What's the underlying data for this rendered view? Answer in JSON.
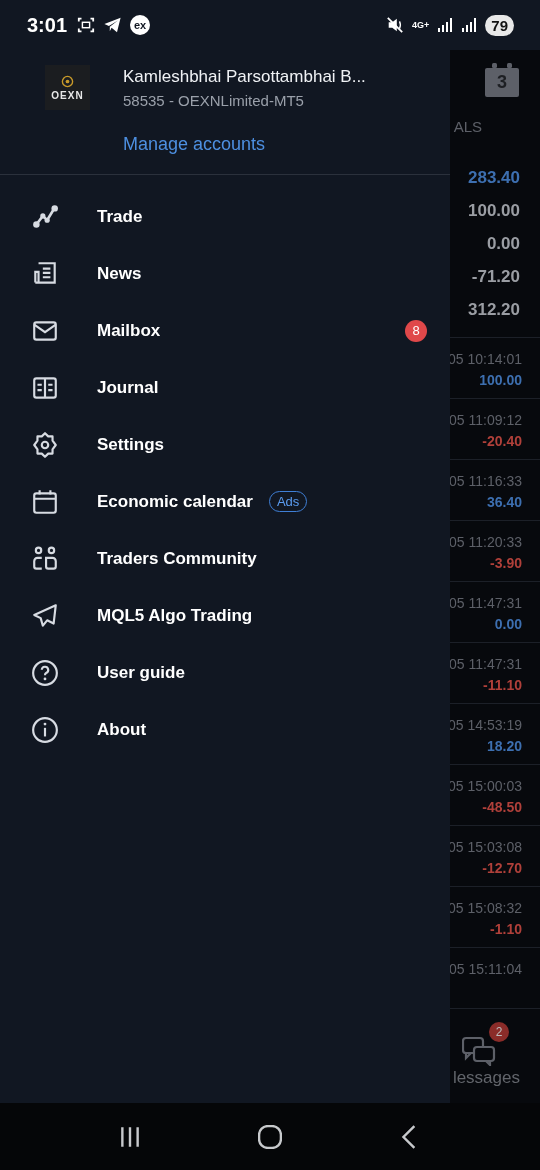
{
  "status_bar": {
    "time": "3:01",
    "app_badge": "ex",
    "network": "4G+",
    "battery": "79"
  },
  "drawer": {
    "account": {
      "logo": "OEXN",
      "name": "Kamleshbhai Parsottambhai B...",
      "server": "58535 - OEXNLimited-MT5"
    },
    "manage_link": "Manage accounts",
    "items": [
      {
        "label": "Trade"
      },
      {
        "label": "News"
      },
      {
        "label": "Mailbox",
        "badge": "8"
      },
      {
        "label": "Journal"
      },
      {
        "label": "Settings"
      },
      {
        "label": "Economic calendar",
        "tag": "Ads"
      },
      {
        "label": "Traders Community"
      },
      {
        "label": "MQL5 Algo Trading"
      },
      {
        "label": "User guide"
      },
      {
        "label": "About"
      }
    ]
  },
  "background": {
    "calendar_day": "3",
    "column_header": "ALS",
    "summary": [
      {
        "value": "283.40",
        "color": "#3d6fb0"
      },
      {
        "value": "100.00",
        "color": "#9a9da3"
      },
      {
        "value": "0.00",
        "color": "#9a9da3"
      },
      {
        "value": "-71.20",
        "color": "#9a9da3"
      },
      {
        "value": "312.20",
        "color": "#9a9da3"
      }
    ],
    "deals": [
      {
        "time": "05 10:14:01",
        "profit": "100.00",
        "color": "#3d6fb0"
      },
      {
        "time": "05 11:09:12",
        "profit": "-20.40",
        "color": "#b0403a"
      },
      {
        "time": "05 11:16:33",
        "profit": "36.40",
        "color": "#3d6fb0"
      },
      {
        "time": "05 11:20:33",
        "profit": "-3.90",
        "color": "#b0403a"
      },
      {
        "time": "05 11:47:31",
        "profit": "0.00",
        "color": "#3d6fb0"
      },
      {
        "time": "05 11:47:31",
        "profit": "-11.10",
        "color": "#b0403a"
      },
      {
        "time": "05 14:53:19",
        "profit": "18.20",
        "color": "#3d6fb0"
      },
      {
        "time": "05 15:00:03",
        "profit": "-48.50",
        "color": "#b0403a"
      },
      {
        "time": "05 15:03:08",
        "profit": "-12.70",
        "color": "#b0403a"
      },
      {
        "time": "05 15:08:32",
        "profit": "-1.10",
        "color": "#b0403a"
      },
      {
        "time": "05 15:11:04"
      }
    ],
    "messages_tab": {
      "label": "lessages",
      "badge": "2"
    }
  }
}
